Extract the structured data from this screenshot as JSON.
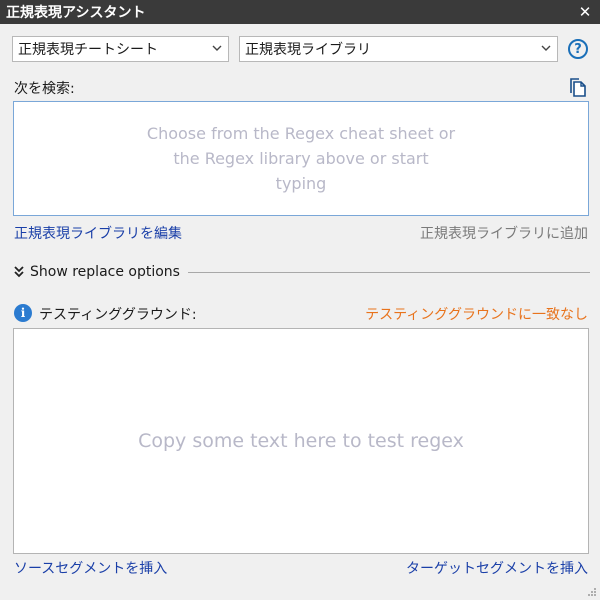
{
  "window": {
    "title": "正規表現アシスタント",
    "close_icon": "close-icon"
  },
  "toolbar": {
    "cheat_sheet_select": "正規表現チートシート",
    "library_select": "正規表現ライブラリ",
    "help_label": "?"
  },
  "search": {
    "label": "次を検索:",
    "placeholder": "Choose from the Regex cheat sheet or the Regex library above or start typing",
    "edit_library_link": "正規表現ライブラリを編集",
    "add_to_library_link": "正規表現ライブラリに追加"
  },
  "replace": {
    "toggle_label": "Show replace options"
  },
  "testing": {
    "label": "テスティンググラウンド:",
    "status": "テスティンググラウンドに一致なし",
    "placeholder": "Copy some text here to test regex",
    "insert_source": "ソースセグメントを挿入",
    "insert_target": "ターゲットセグメントを挿入"
  },
  "colors": {
    "link": "#1a3fa8",
    "warning": "#e8731c",
    "info": "#2b7bd0",
    "titlebar": "#3a3a3a"
  }
}
